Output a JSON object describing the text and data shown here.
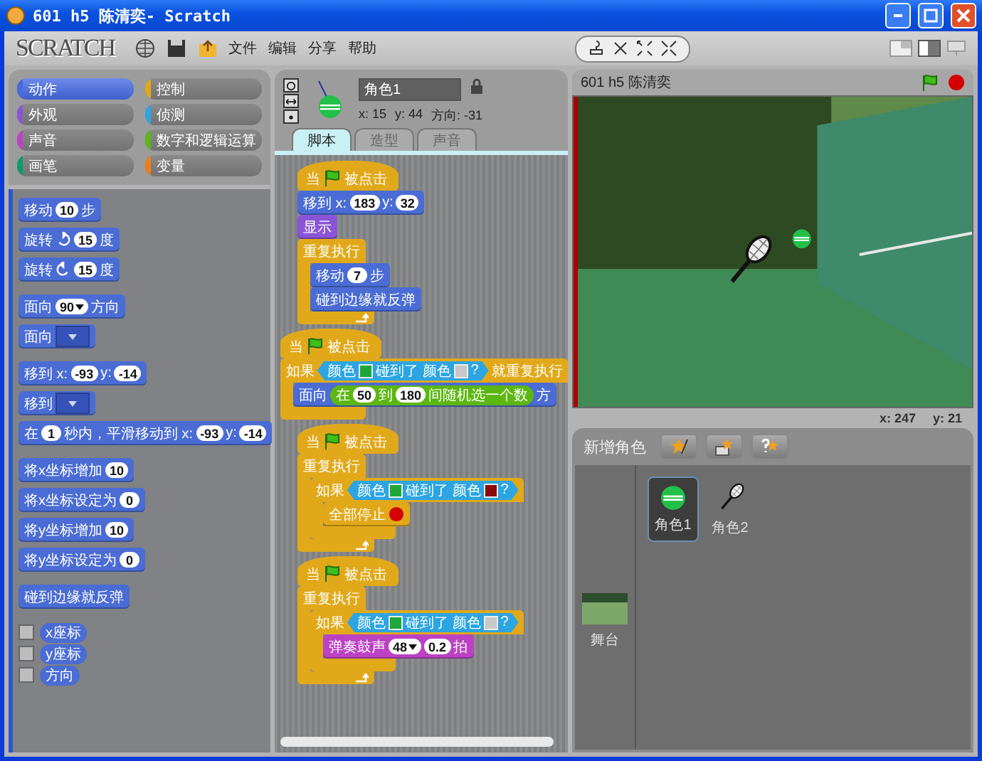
{
  "window": {
    "title": "601 h5 陈清奕- Scratch"
  },
  "menubar": {
    "logo": "SCRATCH",
    "menus": [
      "文件",
      "编辑",
      "分享",
      "帮助"
    ]
  },
  "categories": [
    {
      "label": "动作",
      "color": "#4a6cd4",
      "selected": true
    },
    {
      "label": "控制",
      "color": "#e1a91a",
      "selected": false
    },
    {
      "label": "外观",
      "color": "#8a55d7",
      "selected": false
    },
    {
      "label": "侦测",
      "color": "#2ca5e2",
      "selected": false
    },
    {
      "label": "声音",
      "color": "#bb42c3",
      "selected": false
    },
    {
      "label": "数字和逻辑运算",
      "color": "#5cb712",
      "selected": false
    },
    {
      "label": "画笔",
      "color": "#0e9a6c",
      "selected": false
    },
    {
      "label": "变量",
      "color": "#ee7d16",
      "selected": false
    }
  ],
  "palette": [
    [
      {
        "kind": "stack",
        "color": "#4a6cd4",
        "parts": [
          {
            "kind": "text",
            "text": "移动"
          },
          {
            "kind": "number",
            "text": "10"
          },
          {
            "kind": "text",
            "text": "步"
          }
        ]
      },
      {
        "kind": "stack",
        "color": "#4a6cd4",
        "parts": [
          {
            "kind": "text",
            "text": "旋转"
          },
          {
            "kind": "rotate_cw"
          },
          {
            "kind": "number",
            "text": "15"
          },
          {
            "kind": "text",
            "text": "度"
          }
        ]
      },
      {
        "kind": "stack",
        "color": "#4a6cd4",
        "parts": [
          {
            "kind": "text",
            "text": "旋转"
          },
          {
            "kind": "rotate_ccw"
          },
          {
            "kind": "number",
            "text": "15"
          },
          {
            "kind": "text",
            "text": "度"
          }
        ]
      }
    ],
    [
      {
        "kind": "stack",
        "color": "#4a6cd4",
        "parts": [
          {
            "kind": "text",
            "text": "面向"
          },
          {
            "kind": "dropdown",
            "text": "90"
          },
          {
            "kind": "text",
            "text": "方向"
          }
        ]
      },
      {
        "kind": "stack",
        "color": "#4a6cd4",
        "parts": [
          {
            "kind": "text",
            "text": "面向"
          },
          {
            "kind": "menu_slot"
          }
        ]
      }
    ],
    [
      {
        "kind": "stack",
        "color": "#4a6cd4",
        "parts": [
          {
            "kind": "text",
            "text": "移到 x:"
          },
          {
            "kind": "number",
            "text": "-93"
          },
          {
            "kind": "text",
            "text": "y:"
          },
          {
            "kind": "number",
            "text": "-14"
          }
        ]
      },
      {
        "kind": "stack",
        "color": "#4a6cd4",
        "parts": [
          {
            "kind": "text",
            "text": "移到"
          },
          {
            "kind": "menu_slot"
          }
        ]
      },
      {
        "kind": "stack",
        "color": "#4a6cd4",
        "parts": [
          {
            "kind": "text",
            "text": "在"
          },
          {
            "kind": "number",
            "text": "1"
          },
          {
            "kind": "text",
            "text": "秒内，平滑移动到 x:"
          },
          {
            "kind": "number",
            "text": "-93"
          },
          {
            "kind": "text",
            "text": "y:"
          },
          {
            "kind": "number",
            "text": "-14"
          }
        ]
      }
    ],
    [
      {
        "kind": "stack",
        "color": "#4a6cd4",
        "parts": [
          {
            "kind": "text",
            "text": "将x坐标增加"
          },
          {
            "kind": "number",
            "text": "10"
          }
        ]
      },
      {
        "kind": "stack",
        "color": "#4a6cd4",
        "parts": [
          {
            "kind": "text",
            "text": "将x坐标设定为"
          },
          {
            "kind": "number",
            "text": "0"
          }
        ]
      },
      {
        "kind": "stack",
        "color": "#4a6cd4",
        "parts": [
          {
            "kind": "text",
            "text": "将y坐标增加"
          },
          {
            "kind": "number",
            "text": "10"
          }
        ]
      },
      {
        "kind": "stack",
        "color": "#4a6cd4",
        "parts": [
          {
            "kind": "text",
            "text": "将y坐标设定为"
          },
          {
            "kind": "number",
            "text": "0"
          }
        ]
      }
    ],
    [
      {
        "kind": "stack",
        "color": "#4a6cd4",
        "parts": [
          {
            "kind": "text",
            "text": "碰到边缘就反弹"
          }
        ]
      }
    ],
    [
      {
        "kind": "watcher",
        "color": "#4a6cd4",
        "checked": false,
        "parts": [
          {
            "kind": "text",
            "text": "x座标"
          }
        ]
      },
      {
        "kind": "watcher",
        "color": "#4a6cd4",
        "checked": false,
        "parts": [
          {
            "kind": "text",
            "text": "y座标"
          }
        ]
      },
      {
        "kind": "watcher",
        "color": "#4a6cd4",
        "checked": false,
        "parts": [
          {
            "kind": "text",
            "text": "方向"
          }
        ]
      }
    ]
  ],
  "sprite_info": {
    "name": "角色1",
    "x": "x: 15",
    "y": "y: 44",
    "direction": "方向: -31"
  },
  "tabs": [
    {
      "label": "脚本",
      "selected": true
    },
    {
      "label": "造型",
      "selected": false
    },
    {
      "label": "声音",
      "selected": false
    }
  ],
  "scripts": [
    [
      {
        "kind": "hat",
        "color": "#e1a91a",
        "parts": [
          {
            "kind": "text",
            "text": "当"
          },
          {
            "kind": "flag"
          },
          {
            "kind": "text",
            "text": "被点击"
          }
        ]
      },
      {
        "kind": "stack",
        "color": "#4a6cd4",
        "parts": [
          {
            "kind": "text",
            "text": "移到 x:"
          },
          {
            "kind": "number",
            "text": "183"
          },
          {
            "kind": "text",
            "text": "y:"
          },
          {
            "kind": "number",
            "text": "32"
          }
        ]
      },
      {
        "kind": "stack",
        "color": "#8a55d7",
        "parts": [
          {
            "kind": "text",
            "text": "显示"
          }
        ]
      },
      {
        "kind": "c",
        "color": "#e1a91a",
        "loop": true,
        "parts": [
          {
            "kind": "text",
            "text": "重复执行"
          }
        ],
        "children": [
          {
            "kind": "stack",
            "color": "#4a6cd4",
            "parts": [
              {
                "kind": "text",
                "text": "移动"
              },
              {
                "kind": "number",
                "text": "7"
              },
              {
                "kind": "text",
                "text": "步"
              }
            ]
          },
          {
            "kind": "stack",
            "color": "#4a6cd4",
            "parts": [
              {
                "kind": "text",
                "text": "碰到边缘就反弹"
              }
            ]
          }
        ]
      }
    ],
    [
      {
        "kind": "hat",
        "color": "#e1a91a",
        "parts": [
          {
            "kind": "text",
            "text": "当"
          },
          {
            "kind": "flag"
          },
          {
            "kind": "text",
            "text": "被点击"
          }
        ]
      },
      {
        "kind": "c",
        "color": "#e1a91a",
        "loop": false,
        "parts": [
          {
            "kind": "text",
            "text": "如果"
          },
          {
            "kind": "boolean",
            "color": "#2ca5e2",
            "parts": [
              {
                "kind": "text",
                "text": "颜色"
              },
              {
                "kind": "swatch",
                "color": "#1fa83a"
              },
              {
                "kind": "text",
                "text": "碰到了 颜色"
              },
              {
                "kind": "swatch",
                "color": "#c8c8c8"
              },
              {
                "kind": "text",
                "text": "?"
              }
            ]
          },
          {
            "kind": "text",
            "text": "就重复执行"
          }
        ],
        "children": [
          {
            "kind": "stack",
            "color": "#4a6cd4",
            "parts": [
              {
                "kind": "text",
                "text": "面向"
              },
              {
                "kind": "reporter",
                "color": "#5cb712",
                "parts": [
                  {
                    "kind": "text",
                    "text": "在"
                  },
                  {
                    "kind": "number",
                    "text": "50"
                  },
                  {
                    "kind": "text",
                    "text": "到"
                  },
                  {
                    "kind": "number",
                    "text": "180"
                  },
                  {
                    "kind": "text",
                    "text": "间随机选一个数"
                  }
                ]
              },
              {
                "kind": "text",
                "text": "方"
              }
            ]
          }
        ]
      }
    ],
    [
      {
        "kind": "hat",
        "color": "#e1a91a",
        "parts": [
          {
            "kind": "text",
            "text": "当"
          },
          {
            "kind": "flag"
          },
          {
            "kind": "text",
            "text": "被点击"
          }
        ]
      },
      {
        "kind": "c",
        "color": "#e1a91a",
        "loop": true,
        "parts": [
          {
            "kind": "text",
            "text": "重复执行"
          }
        ],
        "children": [
          {
            "kind": "c",
            "color": "#e1a91a",
            "loop": false,
            "parts": [
              {
                "kind": "text",
                "text": "如果"
              },
              {
                "kind": "boolean",
                "color": "#2ca5e2",
                "parts": [
                  {
                    "kind": "text",
                    "text": "颜色"
                  },
                  {
                    "kind": "swatch",
                    "color": "#1fa83a"
                  },
                  {
                    "kind": "text",
                    "text": "碰到了 颜色"
                  },
                  {
                    "kind": "swatch",
                    "color": "#8b0a0a"
                  },
                  {
                    "kind": "text",
                    "text": "?"
                  }
                ]
              }
            ],
            "children": [
              {
                "kind": "stack",
                "color": "#e1a91a",
                "parts": [
                  {
                    "kind": "text",
                    "text": "全部停止"
                  },
                  {
                    "kind": "stop"
                  }
                ]
              }
            ]
          }
        ]
      }
    ],
    [
      {
        "kind": "hat",
        "color": "#e1a91a",
        "parts": [
          {
            "kind": "text",
            "text": "当"
          },
          {
            "kind": "flag"
          },
          {
            "kind": "text",
            "text": "被点击"
          }
        ]
      },
      {
        "kind": "c",
        "color": "#e1a91a",
        "loop": true,
        "parts": [
          {
            "kind": "text",
            "text": "重复执行"
          }
        ],
        "children": [
          {
            "kind": "c",
            "color": "#e1a91a",
            "loop": false,
            "parts": [
              {
                "kind": "text",
                "text": "如果"
              },
              {
                "kind": "boolean",
                "color": "#2ca5e2",
                "parts": [
                  {
                    "kind": "text",
                    "text": "颜色"
                  },
                  {
                    "kind": "swatch",
                    "color": "#1fa83a"
                  },
                  {
                    "kind": "text",
                    "text": "碰到了 颜色"
                  },
                  {
                    "kind": "swatch",
                    "color": "#c8c8c8"
                  },
                  {
                    "kind": "text",
                    "text": "?"
                  }
                ]
              }
            ],
            "children": [
              {
                "kind": "stack",
                "color": "#bb42c3",
                "parts": [
                  {
                    "kind": "text",
                    "text": "弹奏鼓声"
                  },
                  {
                    "kind": "dropdown",
                    "text": "48"
                  },
                  {
                    "kind": "number",
                    "text": "0.2"
                  },
                  {
                    "kind": "text",
                    "text": "拍"
                  }
                ]
              }
            ]
          }
        ]
      }
    ]
  ],
  "stage": {
    "title": "601 h5 陈清奕",
    "mouse_x": "x: 247",
    "mouse_y": "y: 21"
  },
  "sprite_bar": {
    "label": "新增角色"
  },
  "stage_thumb": {
    "label": "舞台"
  },
  "sprites": [
    {
      "name": "角色1",
      "kind": "ball",
      "selected": true
    },
    {
      "name": "角色2",
      "kind": "racket",
      "selected": false
    }
  ]
}
